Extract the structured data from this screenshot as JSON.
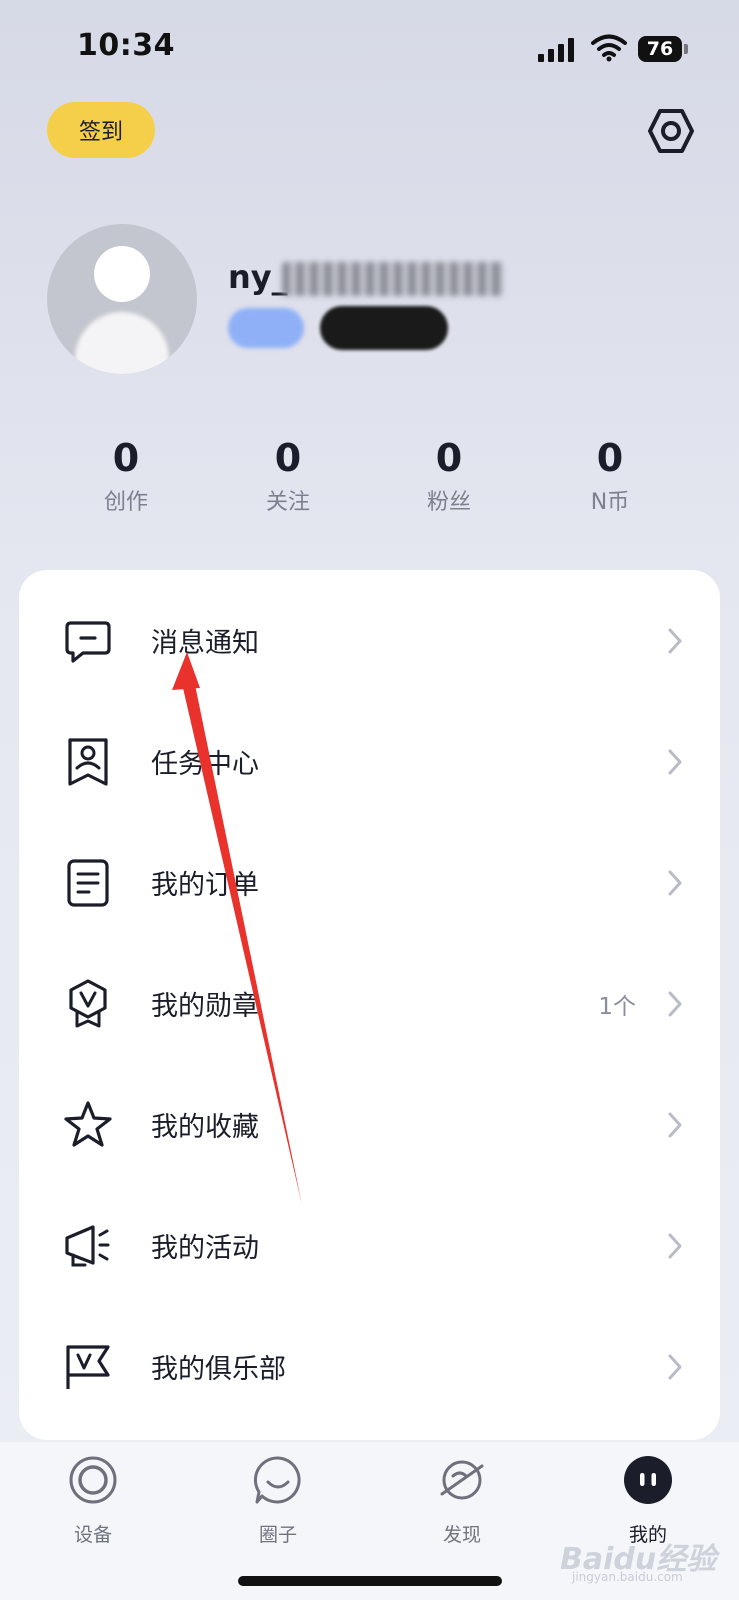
{
  "status_bar": {
    "time": "10:34",
    "battery": "76"
  },
  "header": {
    "checkin_label": "签到"
  },
  "profile": {
    "username_prefix": "ny_"
  },
  "stats": [
    {
      "value": "0",
      "label": "创作"
    },
    {
      "value": "0",
      "label": "关注"
    },
    {
      "value": "0",
      "label": "粉丝"
    },
    {
      "value": "0",
      "label": "N币"
    }
  ],
  "menu": {
    "items": [
      {
        "label": "消息通知",
        "icon": "message-icon",
        "extra": ""
      },
      {
        "label": "任务中心",
        "icon": "task-badge-icon",
        "extra": ""
      },
      {
        "label": "我的订单",
        "icon": "order-document-icon",
        "extra": ""
      },
      {
        "label": "我的勋章",
        "icon": "medal-icon",
        "extra": "1个"
      },
      {
        "label": "我的收藏",
        "icon": "star-icon",
        "extra": ""
      },
      {
        "label": "我的活动",
        "icon": "megaphone-icon",
        "extra": ""
      },
      {
        "label": "我的俱乐部",
        "icon": "club-flag-icon",
        "extra": ""
      }
    ]
  },
  "tabbar": {
    "tabs": [
      {
        "label": "设备",
        "icon": "device-ring-icon"
      },
      {
        "label": "圈子",
        "icon": "circle-chat-icon"
      },
      {
        "label": "发现",
        "icon": "planet-icon"
      },
      {
        "label": "我的",
        "icon": "profile-face-icon"
      }
    ],
    "active_index": 3
  },
  "watermark": {
    "text": "Baidu经验",
    "sub": "jingyan.baidu.com"
  },
  "colors": {
    "accent_yellow": "#f5cf4a",
    "annotation_red": "#e8322b"
  }
}
